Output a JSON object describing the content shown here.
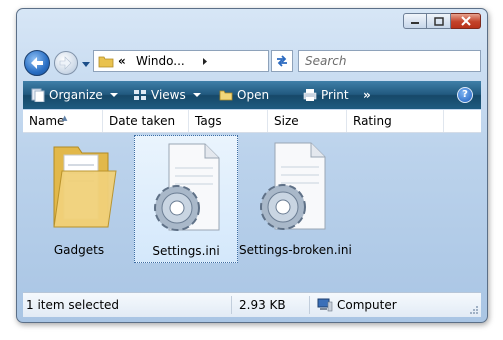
{
  "window": {
    "controls": [
      "minimize-icon",
      "maximize-icon",
      "close-icon"
    ]
  },
  "address_bar": {
    "prefix": "«",
    "path": "Windo...",
    "search_placeholder": "Search"
  },
  "toolbar": {
    "organize": "Organize",
    "views": "Views",
    "open": "Open",
    "print": "Print",
    "more": "»",
    "help": "?"
  },
  "columns": [
    "Name",
    "Date taken",
    "Tags",
    "Size",
    "Rating"
  ],
  "files": [
    {
      "name": "Gadgets",
      "icon": "folder-icon",
      "selected": false
    },
    {
      "name": "Settings.ini",
      "icon": "settings-file-icon",
      "selected": true
    },
    {
      "name": "Settings-broken.ini",
      "icon": "settings-file-icon",
      "selected": false
    }
  ],
  "status": {
    "selection": "1 item selected",
    "size": "2.93 KB",
    "location": "Computer"
  },
  "colors": {
    "toolbar": "#1f5b80",
    "selection": "#d4e8fb",
    "close_button": "#c3432a"
  }
}
